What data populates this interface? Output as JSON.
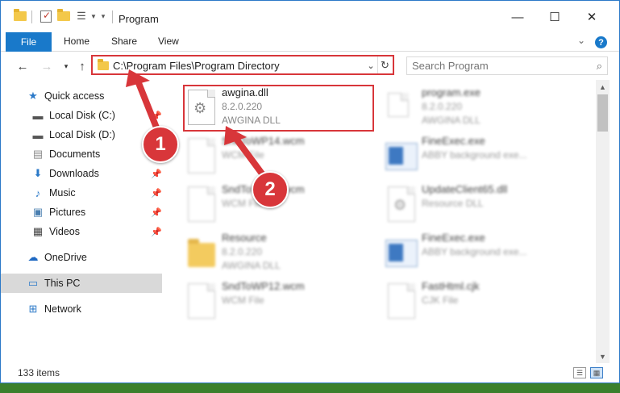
{
  "window": {
    "title": "Program",
    "minimize": "—",
    "maximize": "☐",
    "close": "✕"
  },
  "ribbon": {
    "tabs": [
      "File",
      "Home",
      "Share",
      "View"
    ],
    "help": "?"
  },
  "nav": {
    "address": "C:\\Program Files\\Program Directory",
    "search_placeholder": "Search Program"
  },
  "sidebar": {
    "items": [
      {
        "label": "Quick access",
        "icon": "star-icon"
      },
      {
        "label": "Local Disk (C:)",
        "icon": "drive-icon",
        "pinned": true
      },
      {
        "label": "Local Disk (D:)",
        "icon": "drive-icon"
      },
      {
        "label": "Documents",
        "icon": "documents-icon"
      },
      {
        "label": "Downloads",
        "icon": "download-icon",
        "pinned": true
      },
      {
        "label": "Music",
        "icon": "music-icon",
        "pinned": true
      },
      {
        "label": "Pictures",
        "icon": "pictures-icon",
        "pinned": true
      },
      {
        "label": "Videos",
        "icon": "videos-icon",
        "pinned": true
      },
      {
        "label": "OneDrive",
        "icon": "cloud-icon"
      },
      {
        "label": "This PC",
        "icon": "computer-icon",
        "selected": true
      },
      {
        "label": "Network",
        "icon": "network-icon"
      }
    ]
  },
  "files": [
    {
      "name": "awgina.dll",
      "line2": "8.2.0.220",
      "line3": "AWGINA  DLL",
      "kind": "dll"
    },
    {
      "name": "program.exe",
      "line2": "8.2.0.220",
      "line3": "AWGINA  DLL",
      "kind": "exe-small"
    },
    {
      "name": "SndToWP14.wcm",
      "line2": "WCM File",
      "line3": "",
      "kind": "doc"
    },
    {
      "name": "FineExec.exe",
      "line2": "ABBY background exe...",
      "line3": "",
      "kind": "exe"
    },
    {
      "name": "SndToWP13.wcm",
      "line2": "WCM File",
      "line3": "",
      "kind": "doc"
    },
    {
      "name": "UpdateClient65.dll",
      "line2": "Resource DLL",
      "line3": "",
      "kind": "dll"
    },
    {
      "name": "Resource",
      "line2": "8.2.0.220",
      "line3": "AWGINA  DLL",
      "kind": "folder"
    },
    {
      "name": "FineExec.exe",
      "line2": "ABBY background exe...",
      "line3": "",
      "kind": "exe"
    },
    {
      "name": "SndToWP12.wcm",
      "line2": "WCM File",
      "line3": "",
      "kind": "doc"
    },
    {
      "name": "FastHtml.cjk",
      "line2": "CJK File",
      "line3": "",
      "kind": "doc"
    }
  ],
  "status": {
    "item_count": "133 items"
  },
  "callouts": {
    "step1": "1",
    "step2": "2",
    "color": "#d8363a"
  }
}
